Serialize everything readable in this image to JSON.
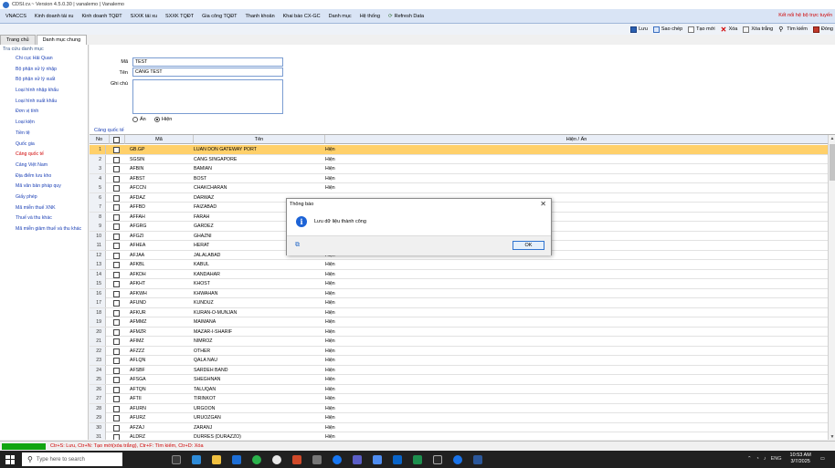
{
  "window": {
    "title": "CDSI.cv.~ Version 4.5.0.30 | vanalemo | Vanalemo"
  },
  "menu": {
    "items": [
      "VNACCS",
      "Kinh doanh tái xu",
      "Kinh doanh TQĐT",
      "SXXK tái xu",
      "SXXK TQĐT",
      "Gia công TQĐT",
      "Thanh khoản",
      "Khai báo CX-GC",
      "Danh mục",
      "Hệ thống",
      "Refresh Data"
    ],
    "right_status": "Kết nối hệ bộ trực tuyến"
  },
  "toolbar": {
    "save": "Lưu",
    "copy": "Sao chép",
    "new": "Tạo mới",
    "delete": "Xóa",
    "clear": "Xóa trắng",
    "search": "Tìm kiếm",
    "close": "Đóng"
  },
  "tabs": [
    {
      "label": "Trang chủ",
      "active": false
    },
    {
      "label": "Danh mục chung",
      "active": true
    }
  ],
  "sidebar": {
    "title": "Tra cứu danh mục",
    "items": [
      "Chi cục Hải Quan",
      "Bộ phận xử lý nhập",
      "Bộ phận xử lý xuất",
      "Loại hình nhập khẩu",
      "Loại hình xuất khẩu",
      "Đơn vị tính",
      "Loại kiện",
      "Tiền tệ",
      "Quốc gia",
      "Cảng quốc tế",
      "Cảng Việt Nam",
      "Địa điểm lưu kho",
      "Mã văn bản pháp quy",
      "Giấy phép",
      "Mã miễn thuế XNK",
      "Thuế và thu khác",
      "Mã miễn giảm thuế và thu khác"
    ],
    "active_index": 9
  },
  "form": {
    "ma_label": "Mã",
    "ma_value": "TEST",
    "ten_label": "Tên",
    "ten_value": "CANG TEST",
    "ghichu_label": "Ghi chú",
    "radio_an": "Ẩn",
    "radio_hien": "Hiện",
    "selected": "hien"
  },
  "grid": {
    "title": "Cảng quốc tế",
    "headers": {
      "no": "No",
      "ma": "Mã",
      "ten": "Tên",
      "hien": "Hiện / Ẩn"
    },
    "rows": [
      [
        "1",
        "GB.GP",
        "LUAN DON GATEWAY PORT",
        "Hiện"
      ],
      [
        "2",
        "SGSIN",
        "CANG SINGAPORE",
        "Hiện"
      ],
      [
        "3",
        "AFBIN",
        "BAMIAN",
        "Hiện"
      ],
      [
        "4",
        "AFBST",
        "BOST",
        "Hiện"
      ],
      [
        "5",
        "AFCCN",
        "CHAKCHARAN",
        "Hiện"
      ],
      [
        "6",
        "AFDAZ",
        "DARWAZ",
        ""
      ],
      [
        "7",
        "AFFBD",
        "FAIZABAD",
        ""
      ],
      [
        "8",
        "AFFAH",
        "FARAH",
        ""
      ],
      [
        "9",
        "AFGRG",
        "GARDEZ",
        ""
      ],
      [
        "10",
        "AFGZI",
        "GHAZNI",
        ""
      ],
      [
        "11",
        "AFHEA",
        "HERAT",
        ""
      ],
      [
        "12",
        "AFJAA",
        "JALALABAD",
        "Hiện"
      ],
      [
        "13",
        "AFKBL",
        "KABUL",
        "Hiện"
      ],
      [
        "14",
        "AFKDH",
        "KANDAHAR",
        "Hiện"
      ],
      [
        "15",
        "AFKHT",
        "KHOST",
        "Hiện"
      ],
      [
        "16",
        "AFKWH",
        "KHWAHAN",
        "Hiện"
      ],
      [
        "17",
        "AFUND",
        "KUNDUZ",
        "Hiện"
      ],
      [
        "18",
        "AFKUR",
        "KURAN-O-MUNJAN",
        "Hiện"
      ],
      [
        "19",
        "AFMMZ",
        "MAIMANA",
        "Hiện"
      ],
      [
        "20",
        "AFMZR",
        "MAZAR-I-SHARIF",
        "Hiện"
      ],
      [
        "21",
        "AFIMZ",
        "NIMROZ",
        "Hiện"
      ],
      [
        "22",
        "AFZZZ",
        "OTHER",
        "Hiện"
      ],
      [
        "23",
        "AFLQN",
        "QALA NAU",
        "Hiện"
      ],
      [
        "24",
        "AFSBF",
        "SARDEH BAND",
        "Hiện"
      ],
      [
        "25",
        "AFSGA",
        "SHEGHNAN",
        "Hiện"
      ],
      [
        "26",
        "AFTQN",
        "TALUQAN",
        "Hiện"
      ],
      [
        "27",
        "AFTII",
        "TIRINKOT",
        "Hiện"
      ],
      [
        "28",
        "AFURN",
        "URGOON",
        "Hiện"
      ],
      [
        "29",
        "AFURZ",
        "URUOZGAN",
        "Hiện"
      ],
      [
        "30",
        "AFZAJ",
        "ZARANJ",
        "Hiện"
      ],
      [
        "31",
        "ALDRZ",
        "DURRES (DURAZZO)",
        "Hiện"
      ]
    ]
  },
  "status": {
    "hint": "Ctr+S: Lưu, Ctr+N: Tạo mới(xóa trắng), Ctr+F: Tìm kiếm, Ctr+D: Xóa"
  },
  "dialog": {
    "title": "Thông báo",
    "message": "Lưu dữ liệu thành công",
    "ok": "OK",
    "close_glyph": "✕",
    "icon_glyph": "i"
  },
  "taskbar": {
    "search_placeholder": "Type here to search",
    "time": "10:53 AM",
    "date": "3/7/2025",
    "lang": "ENG"
  }
}
